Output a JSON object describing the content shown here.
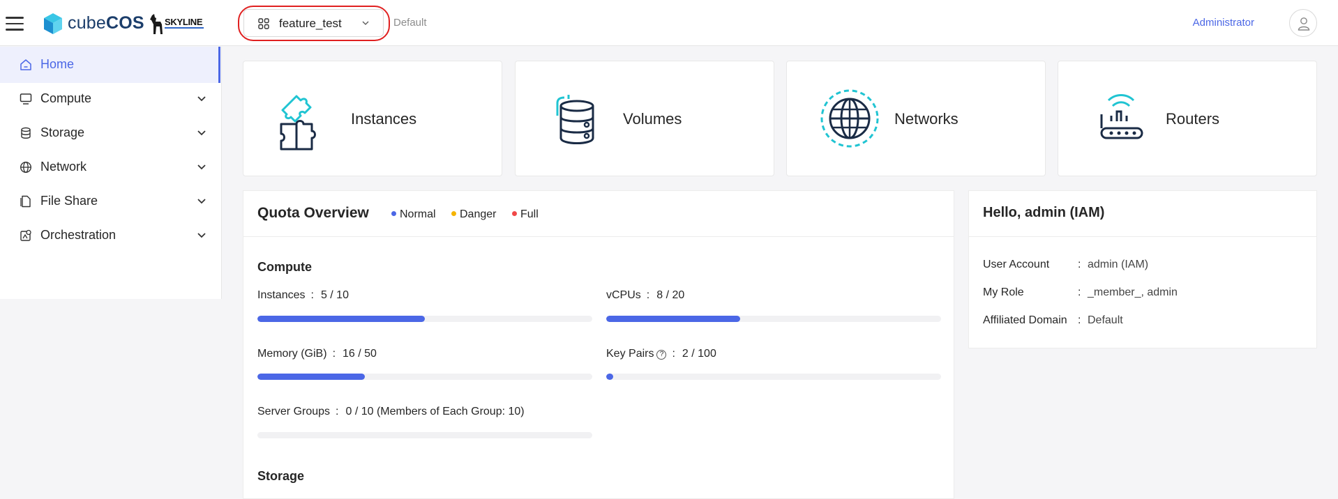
{
  "header": {
    "brand_light": "cube",
    "brand_bold": "COS",
    "skyline_label": "SKYLINE",
    "project_name": "feature_test",
    "domain": "Default",
    "user": "Administrator"
  },
  "sidebar": {
    "items": [
      {
        "label": "Home",
        "icon": "home-icon",
        "active": true
      },
      {
        "label": "Compute",
        "icon": "monitor-icon"
      },
      {
        "label": "Storage",
        "icon": "database-icon"
      },
      {
        "label": "Network",
        "icon": "globe-icon"
      },
      {
        "label": "File Share",
        "icon": "file-icon"
      },
      {
        "label": "Orchestration",
        "icon": "orchestration-icon"
      }
    ]
  },
  "resources": [
    {
      "label": "Instances",
      "icon": "puzzle-icon"
    },
    {
      "label": "Volumes",
      "icon": "database-icon"
    },
    {
      "label": "Networks",
      "icon": "globe-icon"
    },
    {
      "label": "Routers",
      "icon": "router-icon"
    }
  ],
  "quota": {
    "title": "Quota Overview",
    "legend": [
      {
        "label": "Normal",
        "color": "#4b67e6"
      },
      {
        "label": "Danger",
        "color": "#f5b400"
      },
      {
        "label": "Full",
        "color": "#f04848"
      }
    ],
    "compute_title": "Compute",
    "items": [
      {
        "label": "Instances",
        "value": "5 / 10",
        "used": 5,
        "total": 10
      },
      {
        "label": "vCPUs",
        "value": "8 / 20",
        "used": 8,
        "total": 20
      },
      {
        "label": "Memory (GiB)",
        "value": "16 / 50",
        "used": 16,
        "total": 50
      },
      {
        "label": "Key Pairs",
        "value": "2 / 100",
        "used": 2,
        "total": 100
      },
      {
        "label": "Server Groups",
        "value": "0 / 10 (Members of Each Group: 10)",
        "used": 0,
        "total": 10
      }
    ],
    "storage_title": "Storage"
  },
  "hello": {
    "title": "Hello, admin (IAM)",
    "rows": [
      {
        "key": "User Account",
        "value": "admin (IAM)"
      },
      {
        "key": "My Role",
        "value": "_member_, admin"
      },
      {
        "key": "Affiliated Domain",
        "value": "Default"
      }
    ]
  },
  "colors": {
    "accent": "#4b67e6",
    "ring": "#e02020",
    "icon_teal": "#20c4d2",
    "icon_navy": "#1a2b45"
  }
}
